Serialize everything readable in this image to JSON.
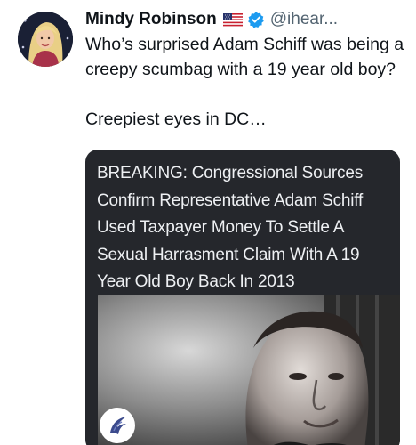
{
  "tweet": {
    "author": {
      "display_name": "Mindy Robinson",
      "flag_icon": "us-flag-icon",
      "verified_icon": "verified-badge-icon",
      "handle": "@ihear..."
    },
    "text_paragraphs": [
      "Who’s surprised Adam Schiff was being a creepy scumbag with a 19 year old boy?",
      "Creepiest eyes in DC…"
    ],
    "card": {
      "headline": "BREAKING: Congressional Sources Confirm Representative Adam Schiff Used Taxpayer Money To Settle A Sexual Harrasment Claim With A 19 Year Old Boy Back In 2013",
      "logo_icon": "eagle-logo-icon"
    }
  },
  "colors": {
    "verified_blue": "#1d9bf0",
    "handle_gray": "#536471",
    "card_bg": "#25272c",
    "card_text": "#eef0f3"
  }
}
